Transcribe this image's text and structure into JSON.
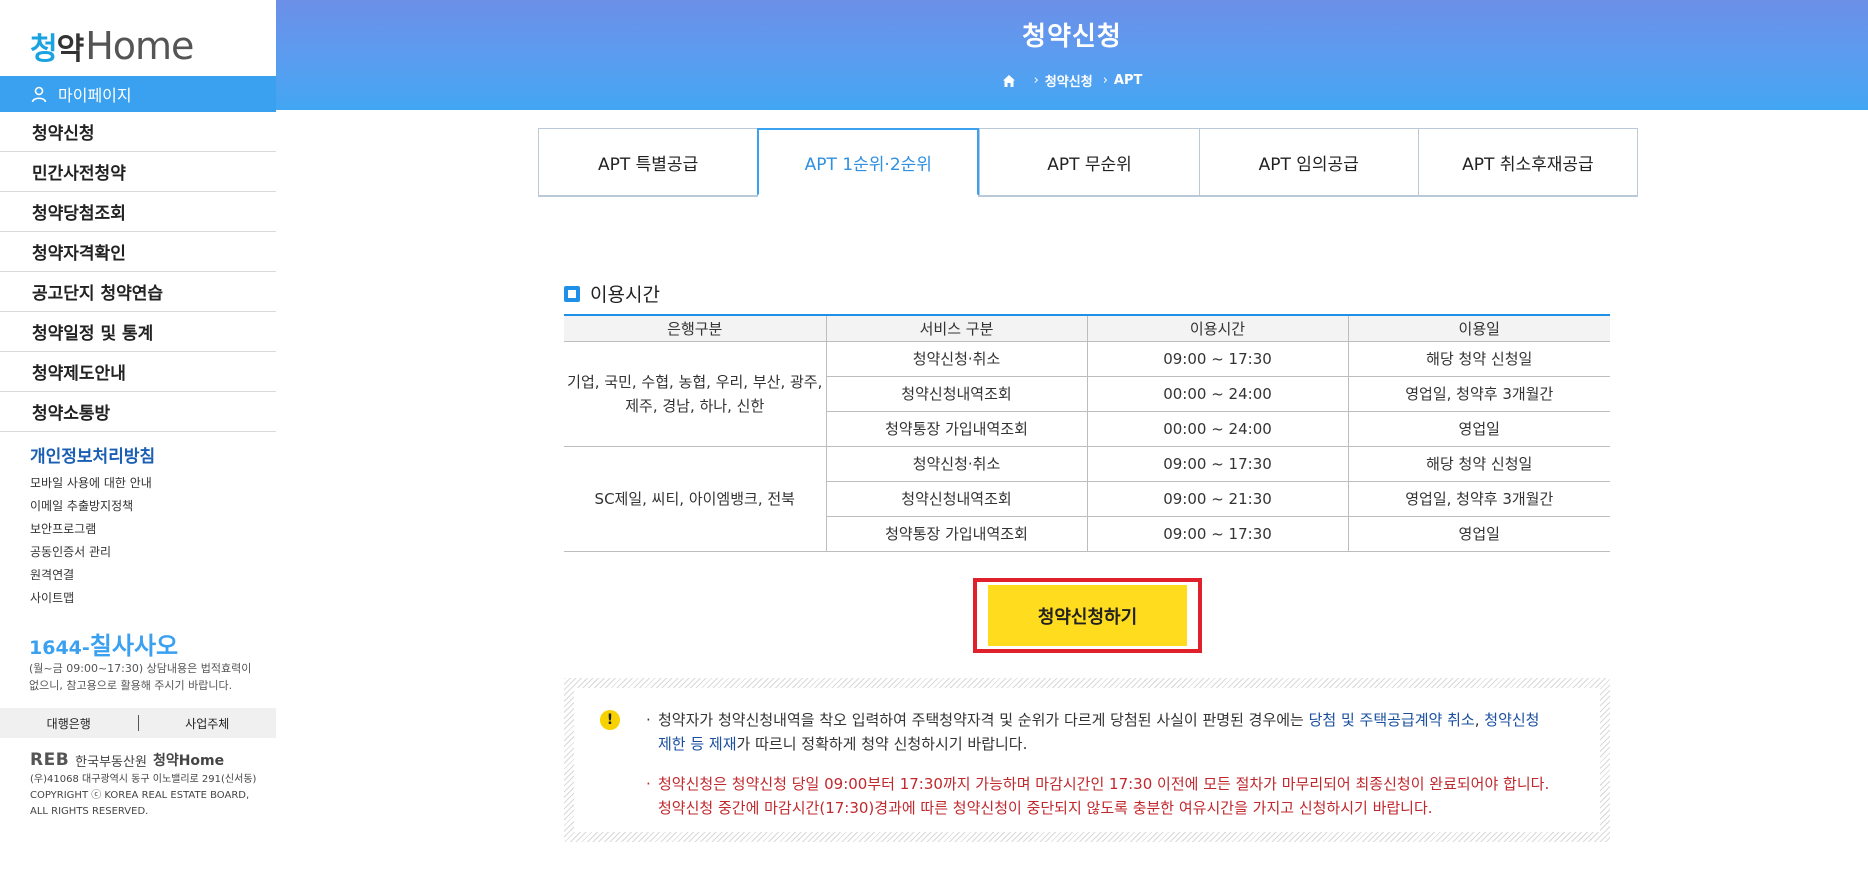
{
  "sidebar": {
    "logo_ko": "청약",
    "logo_en": "Home",
    "mypage": "마이페이지",
    "menu": [
      "청약신청",
      "민간사전청약",
      "청약당첨조회",
      "청약자격확인",
      "공고단지 청약연습",
      "청약일정 및 통계",
      "청약제도안내",
      "청약소통방"
    ],
    "privacy": "개인정보처리방침",
    "links": [
      "모바일 사용에 대한 안내",
      "이메일 추출방지정책",
      "보안프로그램",
      "공동인증서 관리",
      "원격연결",
      "사이트맵"
    ],
    "phone_prefix": "1644-",
    "phone_word": "칠사사오",
    "phone_note": "(월~금 09:00~17:30) 상담내용은 법적효력이 없으니, 참고용으로 활용해 주시기 바랍니다.",
    "bank_bar": [
      "대행은행",
      "사업주체"
    ],
    "footer_reb": "REB",
    "footer_org": "한국부동산원",
    "footer_site": "청약Home",
    "footer_addr": "(우)41068 대구광역시 동구 이노밸리로 291(신서동)",
    "copyright": "COPYRIGHT ⓒ KOREA REAL ESTATE BOARD, ALL RIGHTS RESERVED."
  },
  "header": {
    "title": "청약신청",
    "breadcrumb": [
      "청약신청",
      "APT"
    ]
  },
  "tabs": [
    "APT 특별공급",
    "APT 1순위·2순위",
    "APT 무순위",
    "APT 임의공급",
    "APT 취소후재공급"
  ],
  "section": {
    "title": "이용시간",
    "headers": [
      "은행구분",
      "서비스 구분",
      "이용시간",
      "이용일"
    ],
    "groups": [
      {
        "bank": "기업, 국민, 수협, 농협, 우리, 부산, 광주, 제주, 경남, 하나, 신한",
        "rows": [
          [
            "청약신청·취소",
            "09:00 ~ 17:30",
            "해당 청약 신청일"
          ],
          [
            "청약신청내역조회",
            "00:00 ~ 24:00",
            "영업일, 청약후 3개월간"
          ],
          [
            "청약통장 가입내역조회",
            "00:00 ~ 24:00",
            "영업일"
          ]
        ]
      },
      {
        "bank": "SC제일, 씨티, 아이엠뱅크, 전북",
        "rows": [
          [
            "청약신청·취소",
            "09:00 ~ 17:30",
            "해당 청약 신청일"
          ],
          [
            "청약신청내역조회",
            "09:00 ~ 21:30",
            "영업일, 청약후 3개월간"
          ],
          [
            "청약통장 가입내역조회",
            "09:00 ~ 17:30",
            "영업일"
          ]
        ]
      }
    ]
  },
  "apply_button": "청약신청하기",
  "notice": {
    "p1_a": "청약자가 청약신청내역을 착오 입력하여 주택청약자격 및 순위가 다르게 당첨된 사실이 판명된 경우에는 ",
    "p1_hl1": "당첨 및 주택공급계약 취소",
    "p1_b": ", ",
    "p1_hl2": "청약신청 제한 등 제재",
    "p1_c": "가 따르니 정확하게 청약 신청하시기 바랍니다.",
    "p2": "청약신청은 청약신청 당일 09:00부터 17:30까지 가능하며 마감시간인 17:30 이전에 모든 절차가 마무리되어 최종신청이 완료되어야 합니다. 청약신청 중간에 마감시간(17:30)경과에 따른 청약신청이 중단되지 않도록 충분한 여유시간을 가지고 신청하시기 바랍니다."
  }
}
